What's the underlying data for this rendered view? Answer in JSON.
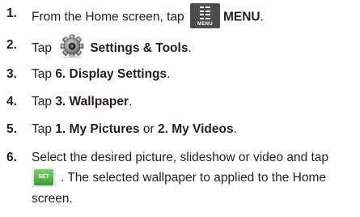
{
  "steps": [
    {
      "number": "1.",
      "before": "From the Home screen, tap ",
      "icon_caption": "MENU",
      "after": "MENU",
      "tail": "."
    },
    {
      "number": "2.",
      "before": "Tap ",
      "after": "Settings & Tools",
      "tail": "."
    },
    {
      "number": "3.",
      "before": "Tap ",
      "bold": "6. Display Settings",
      "tail": "."
    },
    {
      "number": "4.",
      "before": "Tap ",
      "bold": "3. Wallpaper",
      "tail": "."
    },
    {
      "number": "5.",
      "before": "Tap ",
      "bold1": "1. My Pictures",
      "mid": " or ",
      "bold2": "2. My Videos",
      "tail": "."
    },
    {
      "number": "6.",
      "line1": "Select the desired picture, slideshow or video and tap",
      "set_label": "SET",
      "line2": ". The selected wallpaper to applied to the Home",
      "line3": "screen."
    }
  ],
  "icons": {
    "menu": "menu-icon",
    "settings": "gear-icon",
    "set": "set-button-icon"
  },
  "colors": {
    "text": "#231f20",
    "menu_icon_bg": "#4d4d4f",
    "set_green": "#4caf50"
  }
}
